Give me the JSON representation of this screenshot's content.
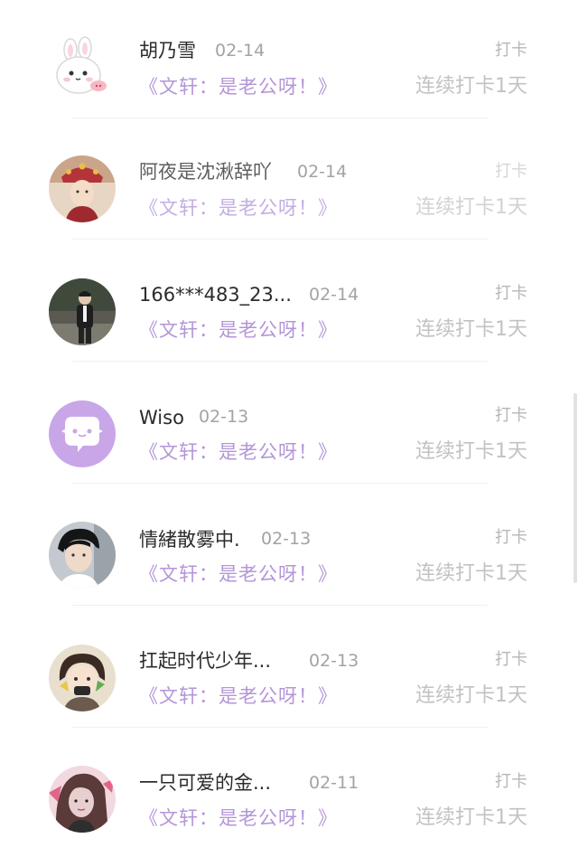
{
  "checkins": [
    {
      "name": "胡乃雪",
      "date": "02-14",
      "book": "《文轩：是老公呀！》",
      "action": "打卡",
      "streak": "连续打卡1天",
      "avatar": "bunny-sticker-icon"
    },
    {
      "name": "阿夜是沈湫辞吖",
      "date": "02-14",
      "book": "《文轩：是老公呀！》",
      "action": "打卡",
      "streak": "连续打卡1天",
      "avatar": "costume-portrait-icon"
    },
    {
      "name": "166***483_23...",
      "date": "02-14",
      "book": "《文轩：是老公呀！》",
      "action": "打卡",
      "streak": "连续打卡1天",
      "avatar": "standing-person-photo-icon"
    },
    {
      "name": "Wiso",
      "date": "02-13",
      "book": "《文轩：是老公呀！》",
      "action": "打卡",
      "streak": "连续打卡1天",
      "avatar": "chat-bubble-icon"
    },
    {
      "name": "情緒散雾中.",
      "date": "02-13",
      "book": "《文轩：是老公呀！》",
      "action": "打卡",
      "streak": "连续打卡1天",
      "avatar": "portrait-photo-icon"
    },
    {
      "name": "扛起时代少年...",
      "date": "02-13",
      "book": "《文轩：是老公呀！》",
      "action": "打卡",
      "streak": "连续打卡1天",
      "avatar": "cartoon-character-icon"
    },
    {
      "name": "一只可爱的金...",
      "date": "02-11",
      "book": "《文轩：是老公呀！》",
      "action": "打卡",
      "streak": "连续打卡1天",
      "avatar": "stylized-portrait-icon"
    }
  ],
  "colors": {
    "book_title": "#b496d8",
    "avatar_purple": "#c9a6e8"
  }
}
